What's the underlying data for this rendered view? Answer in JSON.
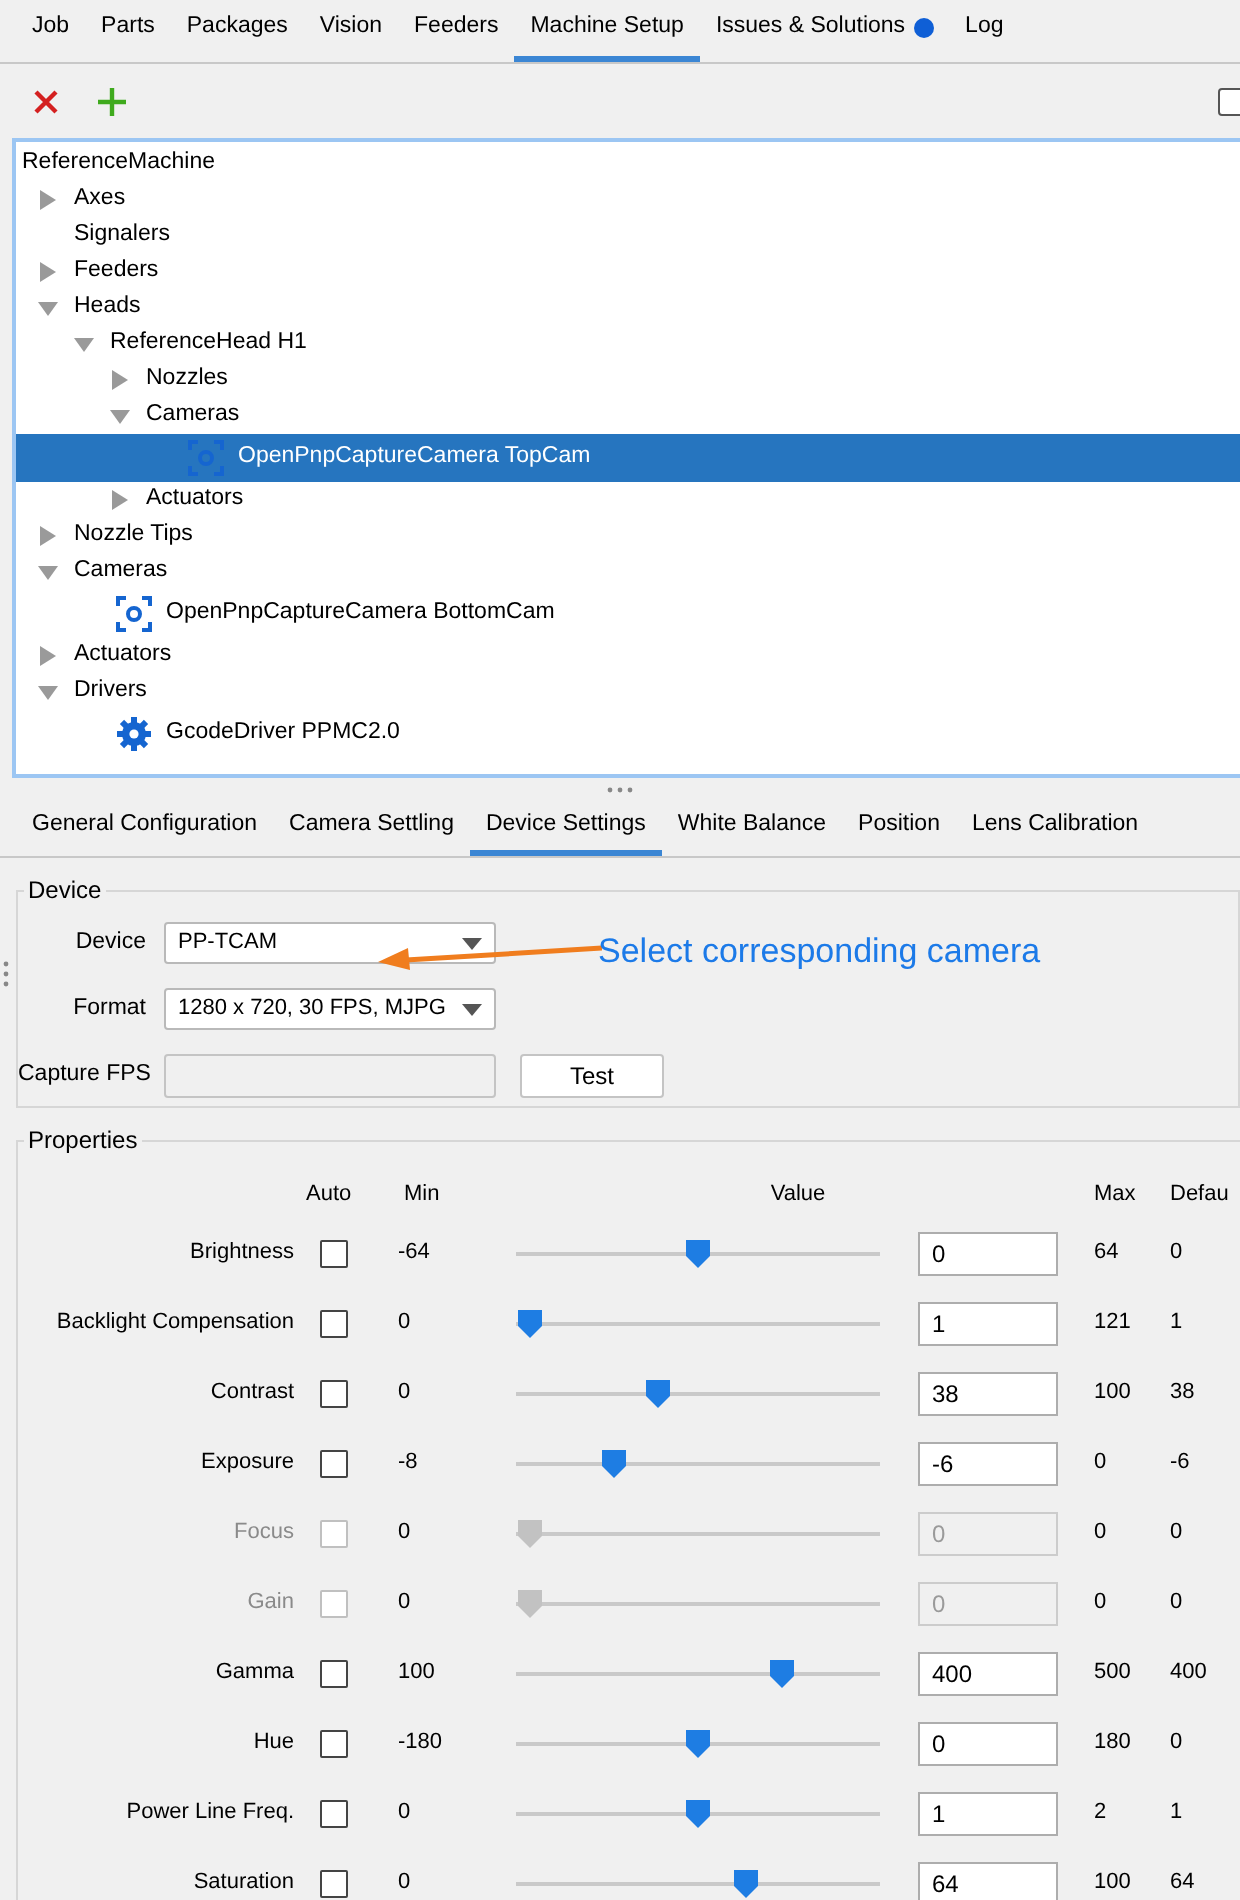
{
  "main_tabs": [
    {
      "label": "Job",
      "selected": false
    },
    {
      "label": "Parts",
      "selected": false
    },
    {
      "label": "Packages",
      "selected": false
    },
    {
      "label": "Vision",
      "selected": false
    },
    {
      "label": "Feeders",
      "selected": false
    },
    {
      "label": "Machine Setup",
      "selected": true
    },
    {
      "label": "Issues & Solutions",
      "selected": false,
      "color": "#0f5fd6"
    },
    {
      "label": "Log",
      "selected": false
    }
  ],
  "toolbar": {
    "checkbox_checked": false
  },
  "tree": {
    "root": "ReferenceMachine",
    "items": [
      {
        "label": "Axes",
        "expanded": false
      },
      {
        "label": "Signalers"
      },
      {
        "label": "Feeders",
        "expanded": false
      },
      {
        "label": "Heads",
        "expanded": true,
        "children": [
          {
            "label": "ReferenceHead H1",
            "expanded": true,
            "children": [
              {
                "label": "Nozzles",
                "expanded": false
              },
              {
                "label": "Cameras",
                "expanded": true,
                "children": [
                  {
                    "label": "OpenPnpCaptureCamera TopCam",
                    "kind": "camera",
                    "selected": true
                  }
                ]
              },
              {
                "label": "Actuators",
                "expanded": false
              }
            ]
          }
        ]
      },
      {
        "label": "Nozzle Tips",
        "expanded": false
      },
      {
        "label": "Cameras",
        "expanded": true,
        "children": [
          {
            "label": "OpenPnpCaptureCamera BottomCam",
            "kind": "camera",
            "selected": false
          }
        ]
      },
      {
        "label": "Actuators",
        "expanded": false
      },
      {
        "label": "Drivers",
        "expanded": true,
        "children": [
          {
            "label": "GcodeDriver PPMC2.0",
            "kind": "driver",
            "selected": false
          }
        ]
      }
    ]
  },
  "detail_tabs": [
    {
      "label": "General Configuration",
      "selected": false
    },
    {
      "label": "Camera Settling",
      "selected": false
    },
    {
      "label": "Device Settings",
      "selected": true
    },
    {
      "label": "White Balance",
      "selected": false
    },
    {
      "label": "Position",
      "selected": false
    },
    {
      "label": "Lens Calibration",
      "selected": false
    }
  ],
  "device_group": {
    "title": "Device",
    "device_label": "Device",
    "device_value": "PP-TCAM",
    "format_label": "Format",
    "format_value": "1280 x 720, 30 FPS, MJPG",
    "fps_label": "Capture FPS",
    "test_button": "Test",
    "annotation": "Select corresponding camera"
  },
  "properties": {
    "title": "Properties",
    "columns": [
      "Auto",
      "Min",
      "Value",
      "Max",
      "Defau"
    ],
    "rows": [
      {
        "name": "Brightness",
        "auto": false,
        "disabled": false,
        "min": "-64",
        "level": 0.5,
        "value": "0",
        "max": "64",
        "default": "0"
      },
      {
        "name": "Backlight Compensation",
        "auto": false,
        "disabled": false,
        "min": "0",
        "level": 0,
        "value": "1",
        "max": "121",
        "default": "1"
      },
      {
        "name": "Contrast",
        "auto": false,
        "disabled": false,
        "min": "0",
        "level": 0.38,
        "value": "38",
        "max": "100",
        "default": "38"
      },
      {
        "name": "Exposure",
        "auto": false,
        "disabled": false,
        "min": "-8",
        "level": 0.25,
        "value": "-6",
        "max": "0",
        "default": "-6"
      },
      {
        "name": "Focus",
        "auto": false,
        "disabled": true,
        "min": "0",
        "level": 0,
        "value": "0",
        "max": "0",
        "default": "0"
      },
      {
        "name": "Gain",
        "auto": false,
        "disabled": true,
        "min": "0",
        "level": 0,
        "value": "0",
        "max": "0",
        "default": "0"
      },
      {
        "name": "Gamma",
        "auto": false,
        "disabled": false,
        "min": "100",
        "level": 0.75,
        "value": "400",
        "max": "500",
        "default": "400"
      },
      {
        "name": "Hue",
        "auto": false,
        "disabled": false,
        "min": "-180",
        "level": 0.5,
        "value": "0",
        "max": "180",
        "default": "0"
      },
      {
        "name": "Power Line Freq.",
        "auto": false,
        "disabled": false,
        "min": "0",
        "level": 0.5,
        "value": "1",
        "max": "2",
        "default": "1"
      },
      {
        "name": "Saturation",
        "auto": false,
        "disabled": false,
        "min": "0",
        "level": 0.64,
        "value": "64",
        "max": "100",
        "default": "64"
      }
    ]
  }
}
